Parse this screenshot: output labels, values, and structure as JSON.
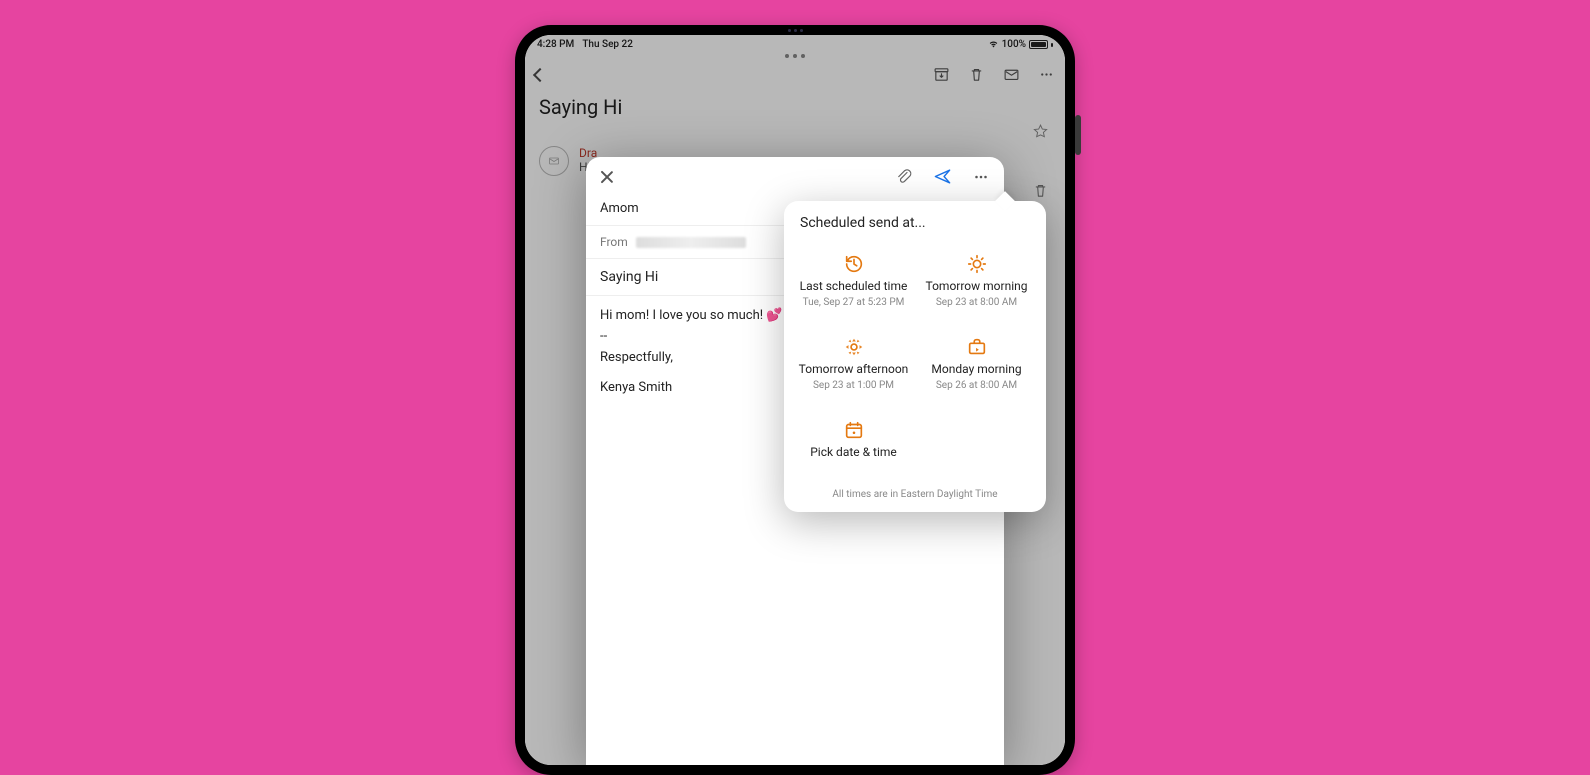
{
  "status": {
    "time": "4:28 PM",
    "date": "Thu Sep 22",
    "battery": "100%"
  },
  "thread": {
    "title": "Saying Hi",
    "draft_label": "Dra",
    "snippet": "Hi m"
  },
  "compose": {
    "to": "Amom",
    "from_label": "From",
    "subject": "Saying Hi",
    "body_line1": "Hi mom! I love you so much! 💕",
    "body_sep": "--",
    "body_sig1": "Respectfully,",
    "body_sig2": "Kenya Smith"
  },
  "popover": {
    "title": "Scheduled send at...",
    "options": [
      {
        "label": "Last scheduled time",
        "sub": "Tue, Sep 27 at 5:23 PM"
      },
      {
        "label": "Tomorrow morning",
        "sub": "Sep 23 at 8:00 AM"
      },
      {
        "label": "Tomorrow afternoon",
        "sub": "Sep 23 at 1:00 PM"
      },
      {
        "label": "Monday morning",
        "sub": "Sep 26 at 8:00 AM"
      },
      {
        "label": "Pick date & time",
        "sub": ""
      }
    ],
    "tz": "All times are in Eastern Daylight Time"
  }
}
